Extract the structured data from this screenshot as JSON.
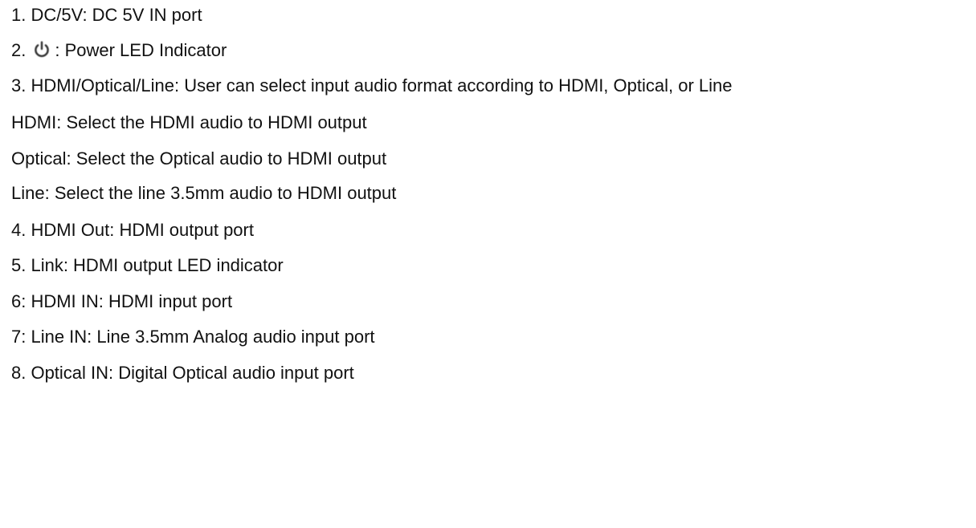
{
  "items": [
    {
      "text": "1. DC/5V: DC 5V IN port"
    },
    {
      "prefix": "2.",
      "icon": "power-icon",
      "suffix": ": Power LED Indicator"
    },
    {
      "text": "3. HDMI/Optical/Line: User can select input audio format according to HDMI, Optical, or Line"
    },
    {
      "text": "HDMI: Select the HDMI audio to HDMI output"
    },
    {
      "text": "Optical: Select the Optical audio to HDMI output"
    },
    {
      "text": "Line: Select the line 3.5mm audio to HDMI output"
    },
    {
      "text": "4. HDMI Out: HDMI output port"
    },
    {
      "text": "5. Link: HDMI output LED indicator"
    },
    {
      "text": "6: HDMI IN: HDMI input port"
    },
    {
      "text": "7: Line IN: Line 3.5mm Analog audio input port"
    },
    {
      "text": "8. Optical IN: Digital Optical audio input port"
    }
  ],
  "colors": {
    "text": "#111111",
    "background": "#ffffff"
  }
}
